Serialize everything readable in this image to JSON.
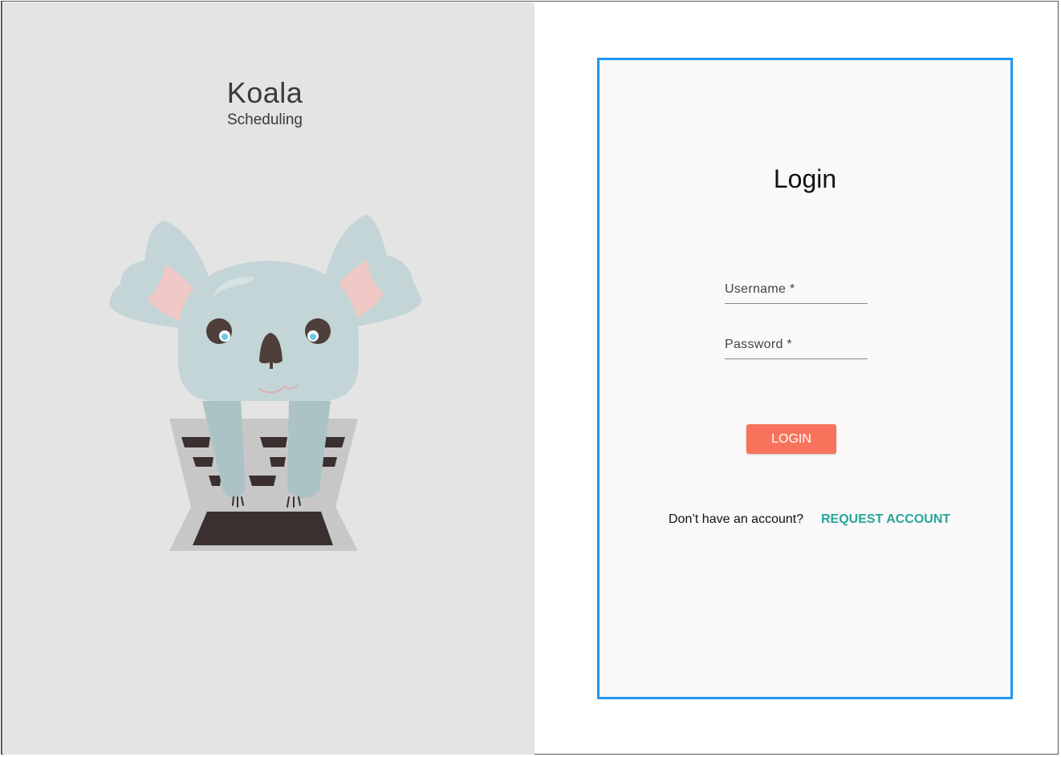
{
  "brand": {
    "title": "Koala",
    "subtitle": "Scheduling"
  },
  "login": {
    "title": "Login",
    "username_label": "Username *",
    "username_value": "",
    "password_label": "Password *",
    "password_value": "",
    "button_label": "LOGIN",
    "no_account_text": "Don’t have an account?",
    "request_link": "REQUEST ACCOUNT"
  },
  "colors": {
    "accent": "#2196f3",
    "button": "#f8735b",
    "link": "#26a69a",
    "left_bg": "#e4e4e4"
  }
}
